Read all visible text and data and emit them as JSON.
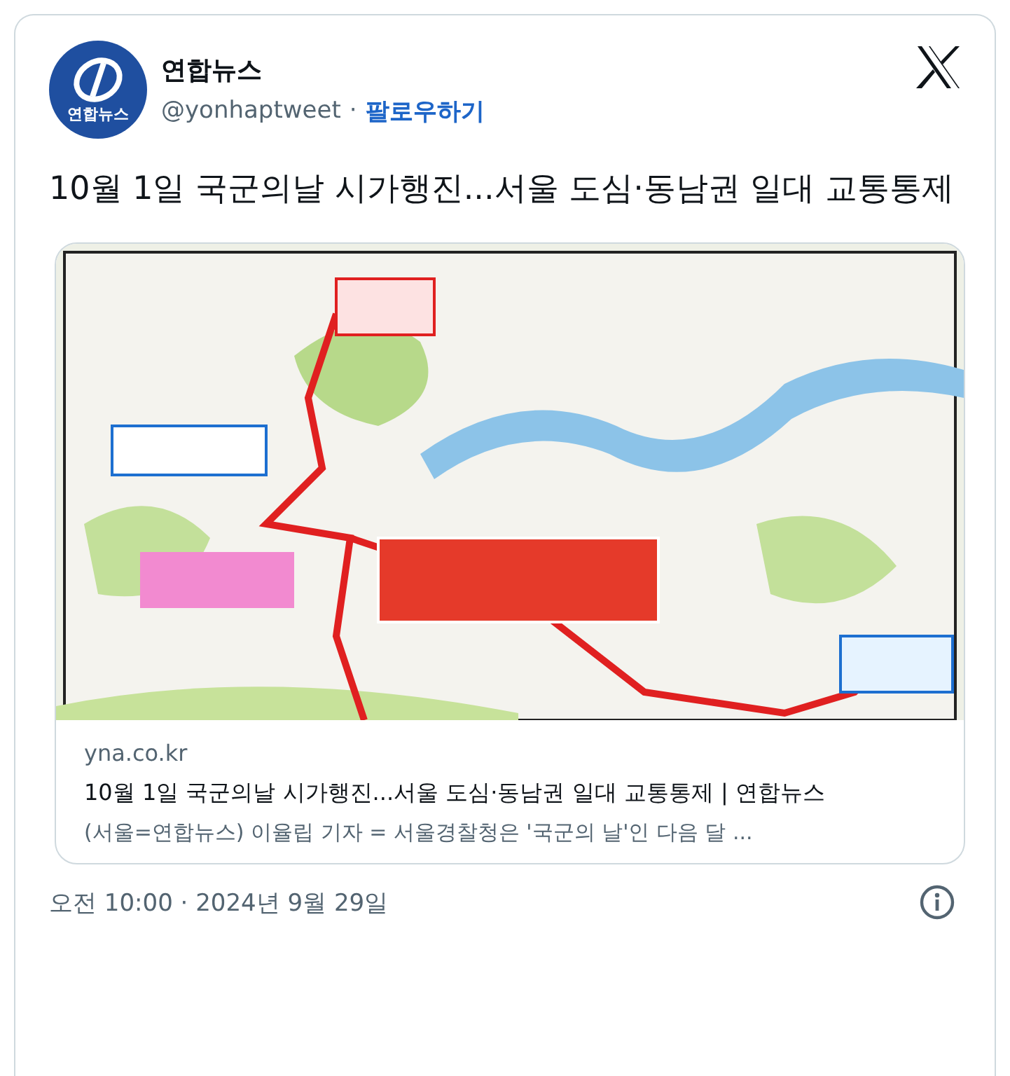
{
  "author": {
    "name": "연합뉴스",
    "avatar_text": "연합뉴스",
    "handle": "@yonhaptweet",
    "separator": "·",
    "follow": "팔로우하기"
  },
  "text": "10월 1일 국군의날 시가행진...서울 도심·동남권 일대 교통통제",
  "link_card": {
    "domain": "yna.co.kr",
    "title": "10월 1일 국군의날 시가행진...서울 도심·동남권 일대 교통통제 | 연합뉴스",
    "description": "(서울=연합뉴스) 이율립 기자 = 서울경찰청은 '국군의 날'인 다음 달 ..."
  },
  "timestamp": "오전 10:00 · 2024년 9월 29일"
}
